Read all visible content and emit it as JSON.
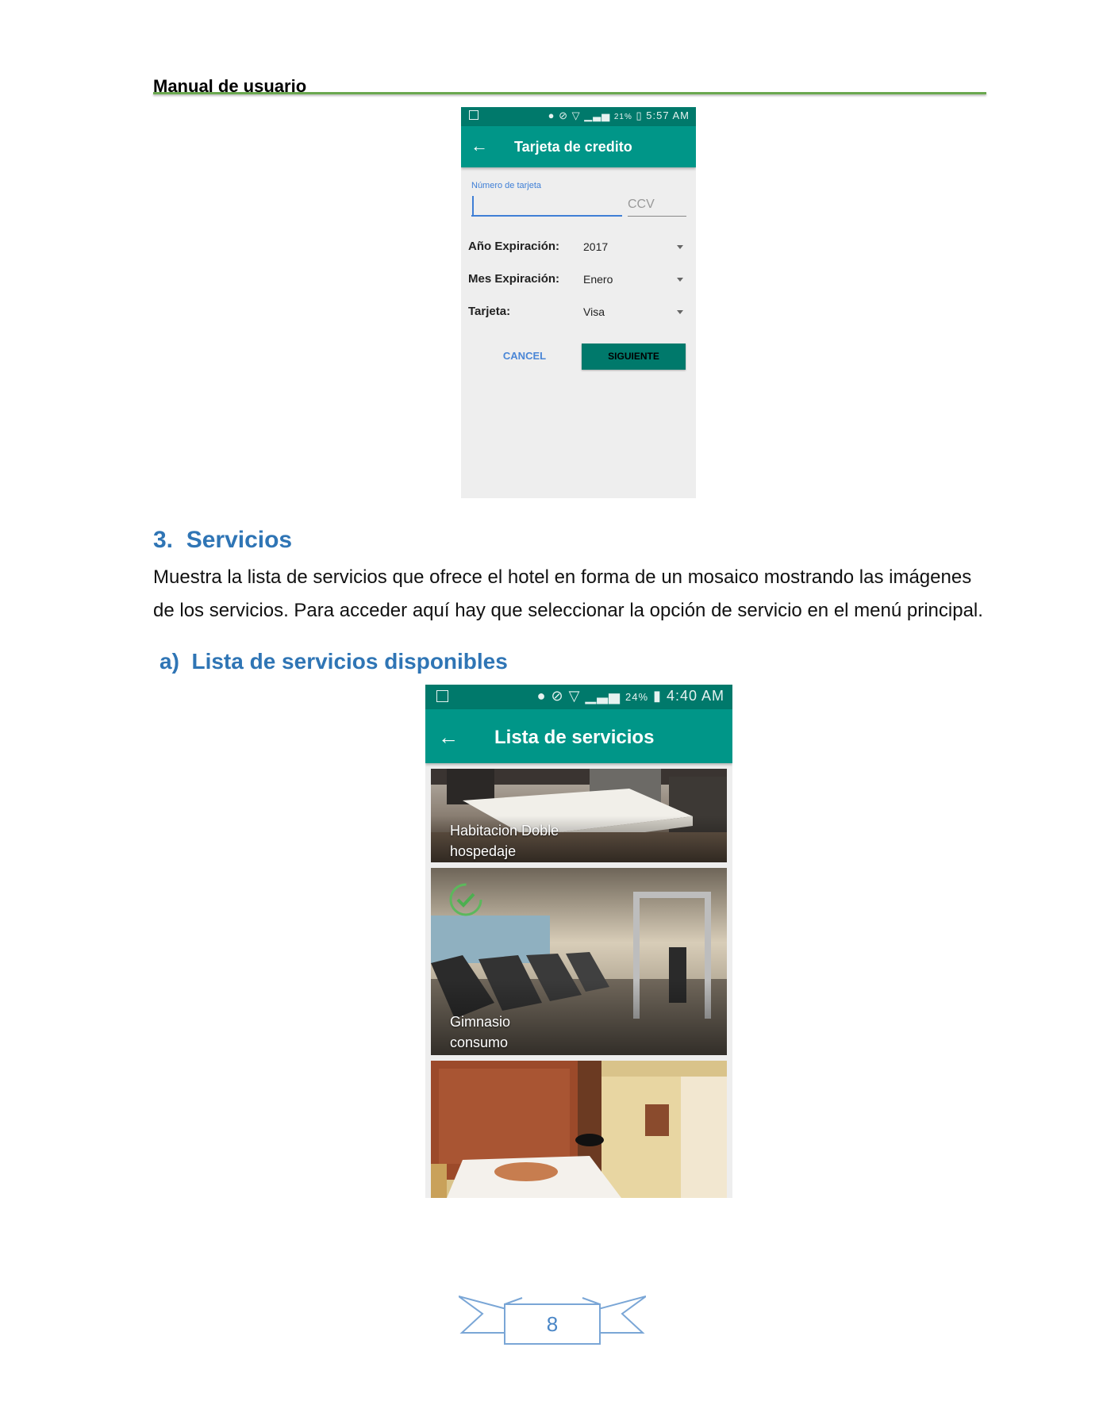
{
  "header": {
    "title": "Manual de usuario"
  },
  "screen1": {
    "status": {
      "battery": "21%",
      "time": "5:57 AM"
    },
    "appbar_title": "Tarjeta de credito",
    "card_number_label": "Número de tarjeta",
    "ccv_placeholder": "CCV",
    "rows": [
      {
        "label": "Año Expiración:",
        "value": "2017"
      },
      {
        "label": "Mes Expiración:",
        "value": "Enero"
      },
      {
        "label": "Tarjeta:",
        "value": "Visa"
      }
    ],
    "cancel_label": "CANCEL",
    "next_label": "SIGUIENTE"
  },
  "section": {
    "number": "3.",
    "title": "Servicios",
    "paragraph_line1": "Muestra la lista de servicios que ofrece el hotel en forma de un mosaico mostrando las imágenes",
    "paragraph_line2": "de los servicios. Para acceder aquí hay que seleccionar la opción de servicio en el menú principal."
  },
  "subsection": {
    "letter": "a)",
    "title": "Lista de servicios disponibles"
  },
  "screen2": {
    "status": {
      "battery": "24%",
      "time": "4:40 AM"
    },
    "appbar_title": "Lista de servicios",
    "tiles": [
      {
        "name": "Habitacion Doble",
        "category": "hospedaje",
        "selected": false,
        "image": "hotel-room-photo"
      },
      {
        "name": "Gimnasio",
        "category": "consumo",
        "selected": true,
        "image": "gym-photo"
      },
      {
        "name": "",
        "category": "",
        "selected": false,
        "image": "hotel-bedroom-photo"
      }
    ]
  },
  "footer": {
    "page_number": "8"
  },
  "colors": {
    "accent_heading": "#2f75b5",
    "teal": "#009688",
    "teal_dark": "#00796b",
    "header_rule": "#6aa84f"
  }
}
